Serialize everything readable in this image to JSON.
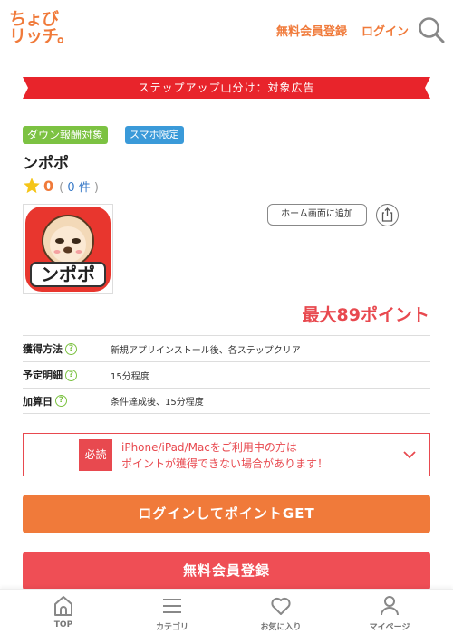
{
  "header": {
    "logo_line1": "ちょび",
    "logo_line2": "リッチ",
    "register_link": "無料会員登録",
    "login_link": "ログイン"
  },
  "banner": {
    "text": "ステップアップ山分け：対象広告"
  },
  "badges": {
    "down": "ダウン報酬対象",
    "smartphone": "スマホ限定"
  },
  "app": {
    "name": "ンポポ",
    "score": "0",
    "review_count_open": "(",
    "review_count": "0 件",
    "review_count_close": ")"
  },
  "actions": {
    "add_home": "ホーム画面に追加"
  },
  "points": "最大89ポイント",
  "info": [
    {
      "label": "獲得方法",
      "value": "新規アプリインストール後、各ステップクリア"
    },
    {
      "label": "予定明細",
      "value": "15分程度"
    },
    {
      "label": "加算日",
      "value": "条件達成後、15分程度"
    }
  ],
  "notice": {
    "badge": "必読",
    "line1": "iPhone/iPad/Macをご利用中の方は",
    "line2": "ポイントが獲得できない場合があります！"
  },
  "buttons": {
    "login": "ログインしてポイントGET",
    "register": "無料会員登録"
  },
  "nav": [
    {
      "label": "TOP",
      "icon": "home-icon"
    },
    {
      "label": "カテゴリ",
      "icon": "menu-icon"
    },
    {
      "label": "お気に入り",
      "icon": "heart-icon"
    },
    {
      "label": "マイページ",
      "icon": "user-icon"
    }
  ],
  "colors": {
    "orange": "#f07a3a",
    "red": "#e8494f",
    "green": "#7cc242",
    "blue": "#3a9ad9"
  }
}
